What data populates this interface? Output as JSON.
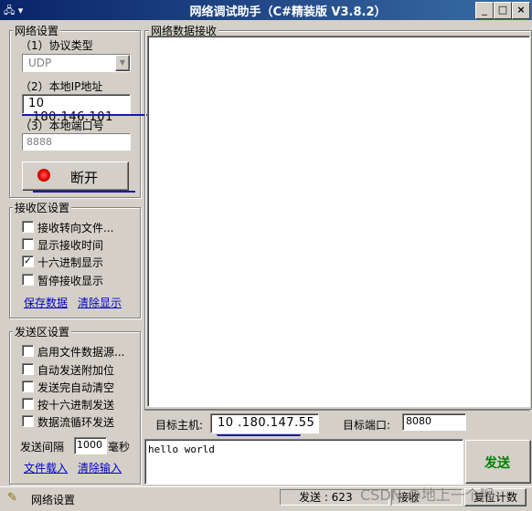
{
  "window": {
    "title": "网络调试助手（C#精装版 V3.8.2）",
    "sys_left": "🖧 ▾",
    "minimize": "_",
    "maximize": "□",
    "close": "×"
  },
  "network": {
    "group_label": "网络设置",
    "protocol_label": "（1）协议类型",
    "protocol_value": "UDP",
    "ip_label": "（2）本地IP地址",
    "ip_value": "10 .180.146.101",
    "port_label": "（3）本地端口号",
    "port_value": "8888",
    "connect_button": "断开"
  },
  "receive": {
    "group_label": "接收区设置",
    "options": [
      {
        "label": "接收转向文件...",
        "checked": false
      },
      {
        "label": "显示接收时间",
        "checked": false
      },
      {
        "label": "十六进制显示",
        "checked": true
      },
      {
        "label": "暂停接收显示",
        "checked": false
      }
    ],
    "save_link": "保存数据",
    "clear_link": "清除显示"
  },
  "send": {
    "group_label": "发送区设置",
    "options": [
      {
        "label": "启用文件数据源...",
        "checked": false
      },
      {
        "label": "自动发送附加位",
        "checked": false
      },
      {
        "label": "发送完自动清空",
        "checked": false
      },
      {
        "label": "按十六进制发送",
        "checked": false
      },
      {
        "label": "数据流循环发送",
        "checked": false
      }
    ],
    "interval_label": "发送间隔",
    "interval_value": "1000",
    "interval_unit": "毫秒",
    "load_link": "文件载入",
    "clear_link": "清除输入"
  },
  "main": {
    "receive_area_label": "网络数据接收",
    "target_host_label": "目标主机:",
    "target_host_value": "10 .180.147.55",
    "target_port_label": "目标端口:",
    "target_port_value": "8080",
    "send_text": "hello world",
    "send_button": "发送"
  },
  "status": {
    "label": "网络设置",
    "send_count": "发送 : 623",
    "recv_label": "接收",
    "reset_button": "复位计数",
    "watermark": "CSDN @地上一个猴"
  },
  "colors": {
    "title_bar": "#0a246a",
    "link": "#0000cc",
    "send_button_text": "#008000",
    "annotation_line": "#1a1aa8"
  }
}
